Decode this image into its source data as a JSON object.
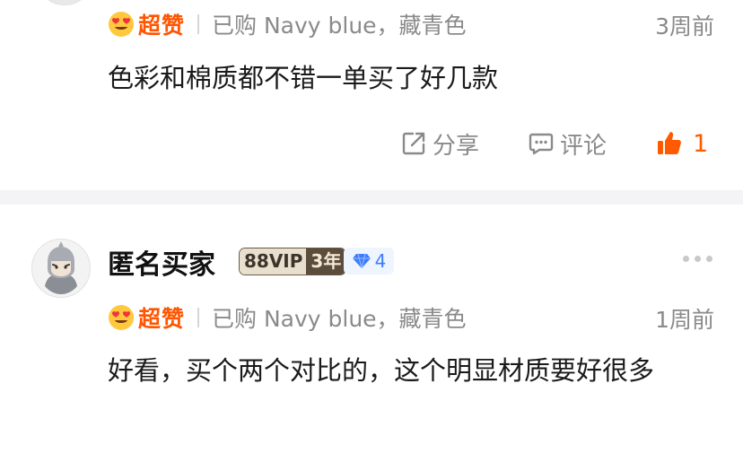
{
  "reviews": [
    {
      "rating_label": "超赞",
      "variant": "已购 Navy blue，藏青色",
      "time": "3周前",
      "text": "色彩和棉质都不错一单买了好几款",
      "actions": {
        "share": "分享",
        "comment": "评论",
        "likes": "1"
      }
    },
    {
      "user": "匿名买家",
      "vip": "88VIP",
      "vip_years": "3年",
      "level": "4",
      "rating_label": "超赞",
      "variant": "已购 Navy blue，藏青色",
      "time": "1周前",
      "text": "好看，买个两个对比的，这个明显材质要好很多"
    }
  ],
  "icons": {
    "rating": "heart-eyes-emoji-icon",
    "share": "share-icon",
    "comment": "comment-icon",
    "like": "thumbs-up-icon",
    "level": "diamond-icon",
    "more": "more-dots-icon"
  },
  "colors": {
    "accent": "#ff5500",
    "muted": "#8a8a8a",
    "level_blue": "#3d7bff"
  }
}
